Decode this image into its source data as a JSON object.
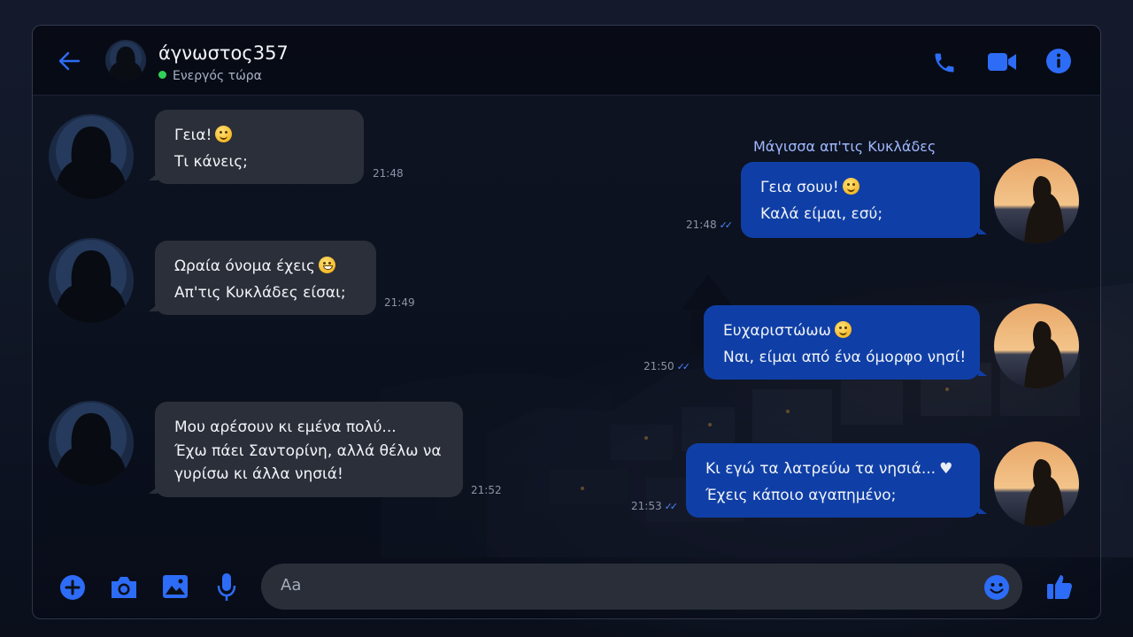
{
  "colors": {
    "accent": "#2d6cf6",
    "outgoing_bubble": "#0f3fa6",
    "incoming_bubble": "#2e323c",
    "online": "#31d158"
  },
  "header": {
    "back_icon": "arrow-left-icon",
    "contact_name": "άγνωστος357",
    "status": "Ενεργός τώρα",
    "actions": [
      "phone-icon",
      "video-icon",
      "info-icon"
    ]
  },
  "sender_label": "Μάγισσα απ'τις Κυκλάδες",
  "messages": [
    {
      "side": "in",
      "lines": [
        "Γεια!",
        "Τι κάνεις;"
      ],
      "emoji": "smile",
      "time": "21:48"
    },
    {
      "side": "out",
      "lines": [
        "Γεια σουυ!",
        "Καλά είμαι, εσύ;"
      ],
      "emoji": "smile",
      "time": "21:48"
    },
    {
      "side": "in",
      "lines": [
        "Ωραία όνομα έχεις",
        "Απ'τις Κυκλάδες είσαι;"
      ],
      "emoji": "grin",
      "time": "21:49"
    },
    {
      "side": "out",
      "lines": [
        "Ευχαριστώωω",
        "Ναι, είμαι από ένα όμορφο νησί!"
      ],
      "emoji": "smile",
      "time": "21:50"
    },
    {
      "side": "in",
      "lines": [
        "Μου αρέσουν κι εμένα πολύ...",
        "Έχω πάει Σαντορίνη, αλλά  θέλω να",
        "γυρίσω κι άλλα νησιά!"
      ],
      "time": "21:52"
    },
    {
      "side": "out",
      "lines": [
        "Κι εγώ τα λατρεύω τα νησιά...",
        "Έχεις κάποιο αγαπημένο;"
      ],
      "emoji": "white-heart",
      "time": "21:53"
    }
  ],
  "composer": {
    "placeholder": "Aa",
    "icons": [
      "plus-icon",
      "camera-icon",
      "image-icon",
      "mic-icon",
      "emoji-icon",
      "thumbs-up-icon"
    ]
  }
}
